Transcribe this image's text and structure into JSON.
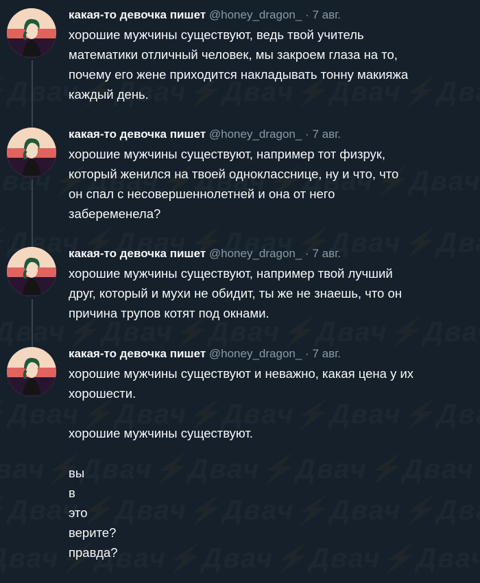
{
  "tweets": [
    {
      "name": "какая-то девочка пишет",
      "handle": "@honey_dragon_",
      "separator": "·",
      "date": "7 авг.",
      "lines": [
        "хорошие мужчины существуют, ведь твой учитель",
        "математики отличный человек, мы закроем глаза на то,",
        "почему его жене приходится накладывать тонну макияжа",
        "каждый день."
      ]
    },
    {
      "name": "какая-то девочка пишет",
      "handle": "@honey_dragon_",
      "separator": "·",
      "date": "7 авг.",
      "lines": [
        "хорошие мужчины существуют, например тот физрук,",
        "который женился на твоей однокласснице, ну и что, что",
        "он спал с несовершеннолетней и она от него",
        "забеременела?"
      ]
    },
    {
      "name": "какая-то девочка пишет",
      "handle": "@honey_dragon_",
      "separator": "·",
      "date": "7 авг.",
      "lines": [
        "хорошие мужчины существуют, например твой лучший",
        "друг, который и мухи не обидит, ты же не знаешь, что он",
        "причина трупов котят под окнами."
      ]
    },
    {
      "name": "какая-то девочка пишет",
      "handle": "@honey_dragon_",
      "separator": "·",
      "date": "7 авг.",
      "lines": [
        "хорошие мужчины существуют и неважно, какая цена у их",
        "хорошести.",
        "",
        "хорошие мужчины существуют.",
        "",
        "вы",
        "в",
        "это",
        "верите?",
        "правда?"
      ]
    }
  ],
  "watermark": "Двач"
}
